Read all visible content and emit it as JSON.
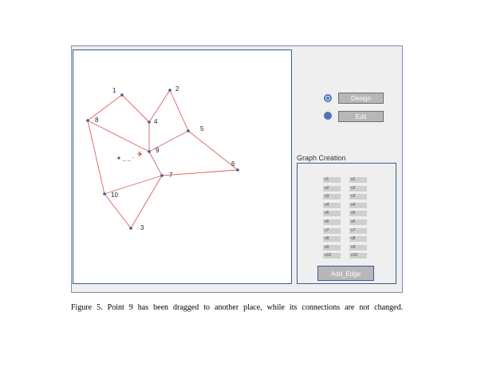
{
  "graph": {
    "nodes": [
      {
        "id": "1",
        "label": "1"
      },
      {
        "id": "2",
        "label": "2"
      },
      {
        "id": "3",
        "label": "3"
      },
      {
        "id": "4",
        "label": "4"
      },
      {
        "id": "5",
        "label": "5"
      },
      {
        "id": "6",
        "label": "6"
      },
      {
        "id": "7",
        "label": "7"
      },
      {
        "id": "8",
        "label": "8"
      },
      {
        "id": "9",
        "label": "9"
      },
      {
        "id": "10",
        "label": "10"
      }
    ],
    "edges": [
      [
        "8",
        "1"
      ],
      [
        "1",
        "4"
      ],
      [
        "4",
        "2"
      ],
      [
        "2",
        "5"
      ],
      [
        "4",
        "9"
      ],
      [
        "8",
        "9"
      ],
      [
        "8",
        "10"
      ],
      [
        "9",
        "5"
      ],
      [
        "9",
        "7"
      ],
      [
        "5",
        "6"
      ],
      [
        "7",
        "6"
      ],
      [
        "10",
        "7"
      ],
      [
        "7",
        "3"
      ],
      [
        "10",
        "3"
      ]
    ],
    "ghost_label": "_ _ -"
  },
  "controls": {
    "design_label": "Design",
    "edit_label": "Edit"
  },
  "graph_creation": {
    "title": "Graph Creation",
    "left_column": [
      "v1",
      "v2",
      "v3",
      "v4",
      "v5",
      "v6",
      "v7",
      "v8",
      "v9",
      "v10"
    ],
    "right_column": [
      "v1",
      "v2",
      "v3",
      "v4",
      "v5",
      "v6",
      "v7",
      "v8",
      "v9",
      "v10"
    ],
    "add_edge_label": "Add_Edge"
  },
  "caption": "Figure 5. Point 9 has been dragged to another place, while its connections are not changed.",
  "colors": {
    "edge": "#e06060",
    "node": "#3c5a99",
    "ghost": "#d03030",
    "accent": "#4f73b5"
  }
}
